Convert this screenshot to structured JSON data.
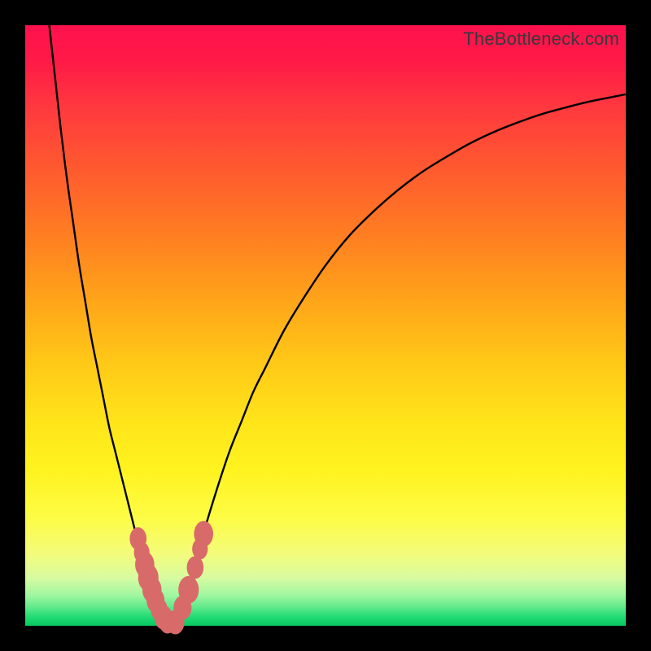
{
  "watermark": "TheBottleneck.com",
  "colors": {
    "frame": "#000000",
    "curve": "#000000",
    "bead": "#d96a6a",
    "gradient_top": "#ff114d",
    "gradient_bottom": "#07c95f"
  },
  "chart_data": {
    "type": "line",
    "title": "",
    "xlabel": "",
    "ylabel": "",
    "xlim": [
      0,
      100
    ],
    "ylim": [
      0,
      100
    ],
    "annotations": [
      "TheBottleneck.com"
    ],
    "series": [
      {
        "name": "left-curve",
        "x": [
          4,
          5,
          6,
          7,
          8,
          9,
          10,
          11,
          12,
          13,
          14,
          15,
          16,
          17,
          18,
          19,
          19.5,
          20,
          20.5,
          21,
          21.5,
          22,
          22.5,
          23,
          23.5
        ],
        "y": [
          100,
          91,
          82,
          74,
          67,
          60,
          54,
          48,
          43,
          38,
          33,
          29,
          25,
          21,
          17,
          13,
          11,
          9,
          7.5,
          6,
          4.5,
          3.2,
          2.1,
          1.1,
          0.3
        ]
      },
      {
        "name": "right-curve",
        "x": [
          25,
          26,
          27,
          28,
          29,
          30,
          32,
          34,
          36,
          38,
          40,
          43,
          46,
          50,
          54,
          58,
          62,
          66,
          70,
          74,
          78,
          82,
          86,
          90,
          94,
          98,
          100
        ],
        "y": [
          0.3,
          2.5,
          5.5,
          9,
          13,
          16.5,
          23,
          29,
          34,
          39,
          43,
          49,
          54,
          60,
          65,
          69,
          72.5,
          75.5,
          78,
          80.3,
          82.2,
          83.8,
          85.2,
          86.3,
          87.3,
          88.1,
          88.5
        ]
      }
    ],
    "beads_left": [
      {
        "x": 18.8,
        "y": 14.5,
        "r": 1.4
      },
      {
        "x": 19.4,
        "y": 12.2,
        "r": 1.3
      },
      {
        "x": 19.9,
        "y": 10.2,
        "r": 1.6
      },
      {
        "x": 20.5,
        "y": 8.0,
        "r": 1.7
      },
      {
        "x": 21.1,
        "y": 6.0,
        "r": 1.6
      },
      {
        "x": 21.7,
        "y": 4.2,
        "r": 1.5
      },
      {
        "x": 22.3,
        "y": 2.7,
        "r": 1.4
      },
      {
        "x": 23.0,
        "y": 1.4,
        "r": 1.5
      },
      {
        "x": 23.7,
        "y": 0.6,
        "r": 1.4
      },
      {
        "x": 25.0,
        "y": 0.6,
        "r": 1.5
      }
    ],
    "beads_right": [
      {
        "x": 26.2,
        "y": 3.0,
        "r": 1.5
      },
      {
        "x": 27.2,
        "y": 6.0,
        "r": 1.7
      },
      {
        "x": 28.3,
        "y": 9.7,
        "r": 1.4
      },
      {
        "x": 29.1,
        "y": 12.8,
        "r": 1.3
      },
      {
        "x": 29.7,
        "y": 15.3,
        "r": 1.6
      }
    ]
  }
}
